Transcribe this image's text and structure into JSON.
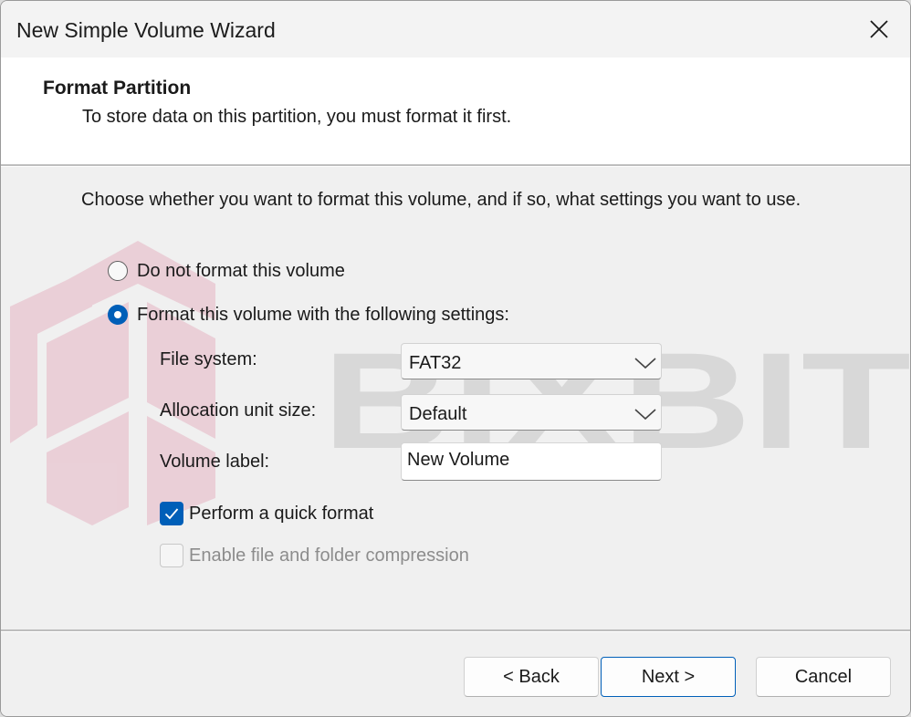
{
  "window": {
    "title": "New Simple Volume Wizard",
    "close_icon": "close-icon"
  },
  "header": {
    "title": "Format Partition",
    "subtitle": "To store data on this partition, you must format it first."
  },
  "body": {
    "instruction": "Choose whether you want to format this volume, and if so, what settings you want to use.",
    "options": [
      {
        "label": "Do not format this volume",
        "selected": false
      },
      {
        "label": "Format this volume with the following settings:",
        "selected": true
      }
    ],
    "fields": {
      "file_system": {
        "label": "File system:",
        "value": "FAT32"
      },
      "allocation_unit_size": {
        "label": "Allocation unit size:",
        "value": "Default"
      },
      "volume_label": {
        "label": "Volume label:",
        "value": "New Volume"
      }
    },
    "checkboxes": [
      {
        "label": "Perform a quick format",
        "checked": true,
        "enabled": true
      },
      {
        "label": "Enable file and folder compression",
        "checked": false,
        "enabled": false
      }
    ]
  },
  "buttons": {
    "back": "< Back",
    "next": "Next >",
    "cancel": "Cancel"
  },
  "watermark": {
    "text": "BIXBIT"
  },
  "colors": {
    "accent": "#005fb8",
    "header_bg": "#ffffff",
    "body_bg": "#f0f0f0",
    "watermark_logo": "#e8c8d2",
    "watermark_text": "#d6d6d6"
  }
}
